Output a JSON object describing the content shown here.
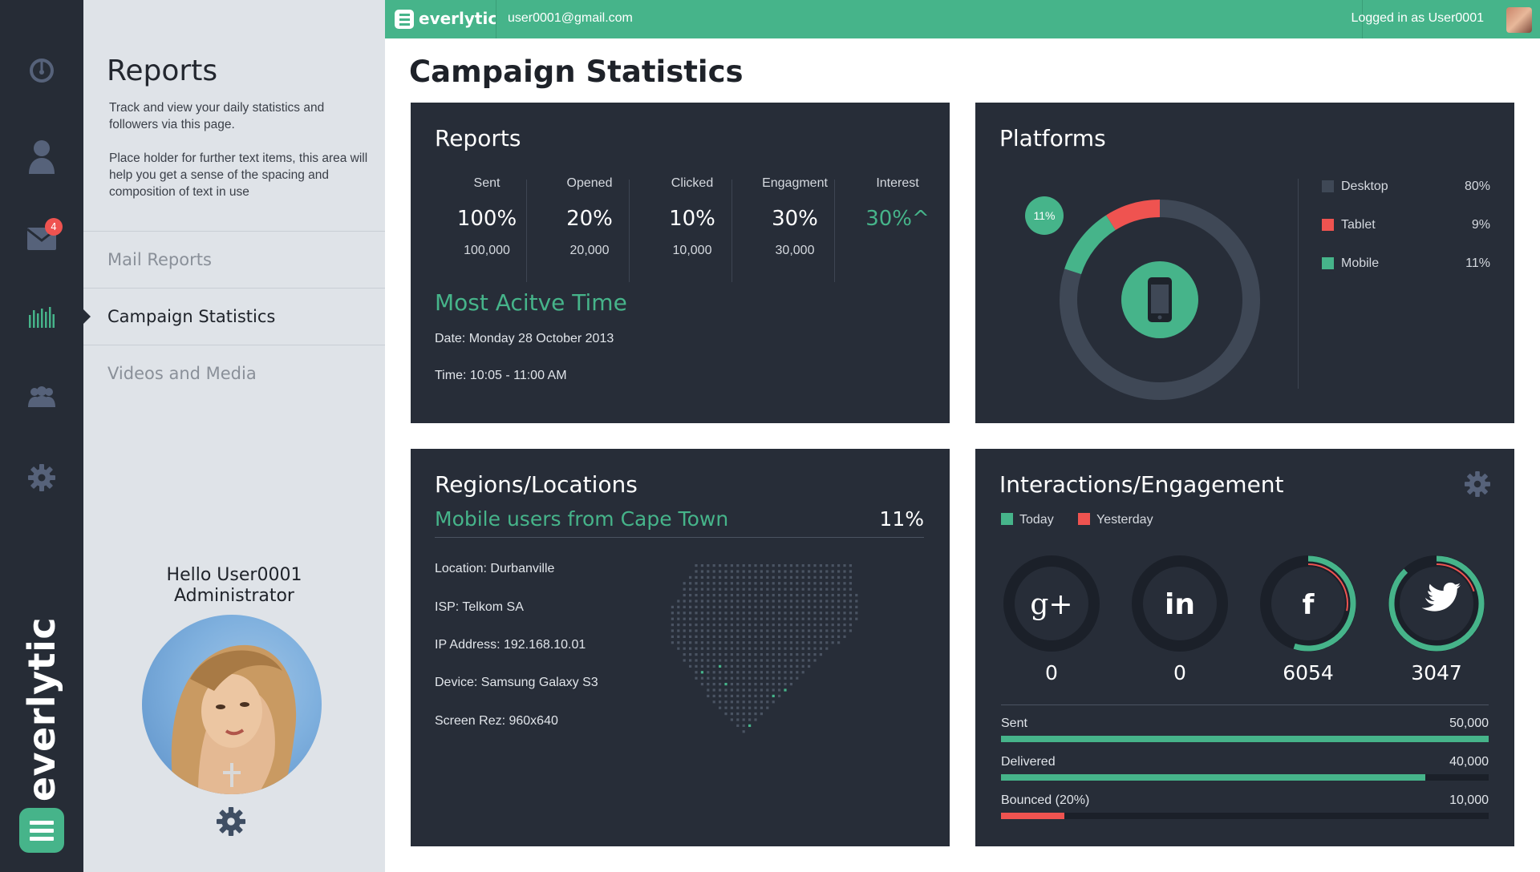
{
  "colors": {
    "accent": "#46b48a",
    "danger": "#ef5350",
    "card_bg": "#272d38",
    "rail_bg": "#262c36",
    "side_bg": "#dfe3e8",
    "platform_grey": "#3f4856"
  },
  "rail": {
    "items": [
      {
        "icon": "dashboard-gauge-icon"
      },
      {
        "icon": "user-icon"
      },
      {
        "icon": "mail-icon",
        "badge": "4"
      },
      {
        "icon": "bar-chart-icon",
        "active": true
      },
      {
        "icon": "group-icon"
      },
      {
        "icon": "gear-icon"
      }
    ],
    "brand": "everlytic"
  },
  "sidebar": {
    "title": "Reports",
    "desc1": "Track and view your daily statistics and followers via this page.",
    "desc2": "Place holder for further text items, this area will help you get a sense of the spacing and composition of text in use",
    "nav": [
      {
        "label": "Mail Reports",
        "active": false
      },
      {
        "label": "Campaign Statistics",
        "active": true
      },
      {
        "label": "Videos and Media",
        "active": false
      }
    ],
    "greeting": "Hello User0001",
    "role": "Administrator"
  },
  "topbar": {
    "brand": "everlytic",
    "email": "user0001@gmail.com",
    "login": "Logged in as User0001"
  },
  "main": {
    "title": "Campaign Statistics"
  },
  "reports": {
    "title": "Reports",
    "stats": [
      {
        "label": "Sent",
        "pct": "100%",
        "count": "100,000"
      },
      {
        "label": "Opened",
        "pct": "20%",
        "count": "20,000"
      },
      {
        "label": "Clicked",
        "pct": "10%",
        "count": "10,000"
      },
      {
        "label": "Engagment",
        "pct": "30%",
        "count": "30,000"
      },
      {
        "label": "Interest",
        "pct": "30%^",
        "count": ""
      }
    ],
    "most_active_title": "Most Acitve Time",
    "date": "Date: Monday 28 October 2013",
    "time": "Time: 10:05 - 11:00 AM"
  },
  "platforms": {
    "title": "Platforms",
    "bubble": "11%",
    "legend": [
      {
        "name": "Desktop",
        "value": "80%",
        "color": "#3f4856",
        "fraction": 0.8
      },
      {
        "name": "Tablet",
        "value": "9%",
        "color": "#ef5350",
        "fraction": 0.09
      },
      {
        "name": "Mobile",
        "value": "11%",
        "color": "#46b48a",
        "fraction": 0.11
      }
    ]
  },
  "regions": {
    "title": "Regions/Locations",
    "subtitle": "Mobile users from Cape Town",
    "pct": "11%",
    "lines": [
      "Location: Durbanville",
      "ISP: Telkom SA",
      "IP Address: 192.168.10.01",
      "Device: Samsung Galaxy S3",
      "Screen Rez: 960x640"
    ]
  },
  "interactions": {
    "title": "Interactions/Engagement",
    "legend": [
      {
        "name": "Today",
        "color": "#46b48a"
      },
      {
        "name": "Yesterday",
        "color": "#ef5350"
      }
    ],
    "social": [
      {
        "icon": "google-plus-icon",
        "glyph": "g+",
        "value": "0",
        "today": 0,
        "yesterday": 0
      },
      {
        "icon": "linkedin-icon",
        "glyph": "in",
        "value": "0",
        "today": 0,
        "yesterday": 0
      },
      {
        "icon": "facebook-icon",
        "glyph": "f",
        "value": "6054",
        "today": 0.55,
        "yesterday": 0.28
      },
      {
        "icon": "twitter-icon",
        "glyph": "",
        "value": "3047",
        "today": 0.88,
        "yesterday": 0.2
      }
    ],
    "bars": [
      {
        "label": "Sent",
        "value": "50,000",
        "fraction": 1.0,
        "color": "#46b48a"
      },
      {
        "label": "Delivered",
        "value": "40,000",
        "fraction": 0.87,
        "color": "#46b48a"
      },
      {
        "label": "Bounced (20%)",
        "value": "10,000",
        "fraction": 0.13,
        "color": "#ef5350"
      }
    ]
  }
}
